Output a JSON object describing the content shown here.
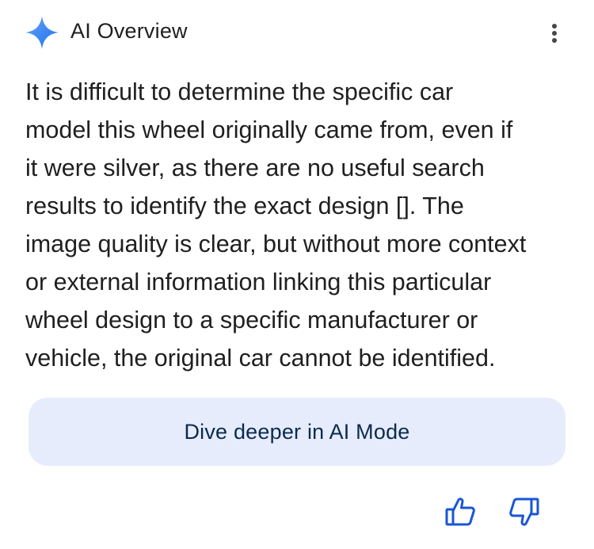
{
  "header": {
    "title": "AI Overview",
    "icon": "sparkle-icon",
    "menu_icon": "more-vert-icon",
    "accent_color": "#4285f4"
  },
  "overview": {
    "lines": [
      "It is difficult to determine the specific car",
      "model this wheel originally came from, even if",
      "it were silver, as there are no useful search",
      "results to identify the exact design []. The",
      "image quality is clear, but without more context",
      "or external information linking this particular",
      "wheel design to a specific manufacturer or",
      "vehicle, the original car cannot be identified."
    ]
  },
  "cta": {
    "label": "Dive deeper in AI Mode",
    "background": "#e6ecfb"
  },
  "feedback": {
    "thumbs_up_icon": "thumbs-up-icon",
    "thumbs_down_icon": "thumbs-down-icon",
    "icon_color": "#1a56d6"
  }
}
